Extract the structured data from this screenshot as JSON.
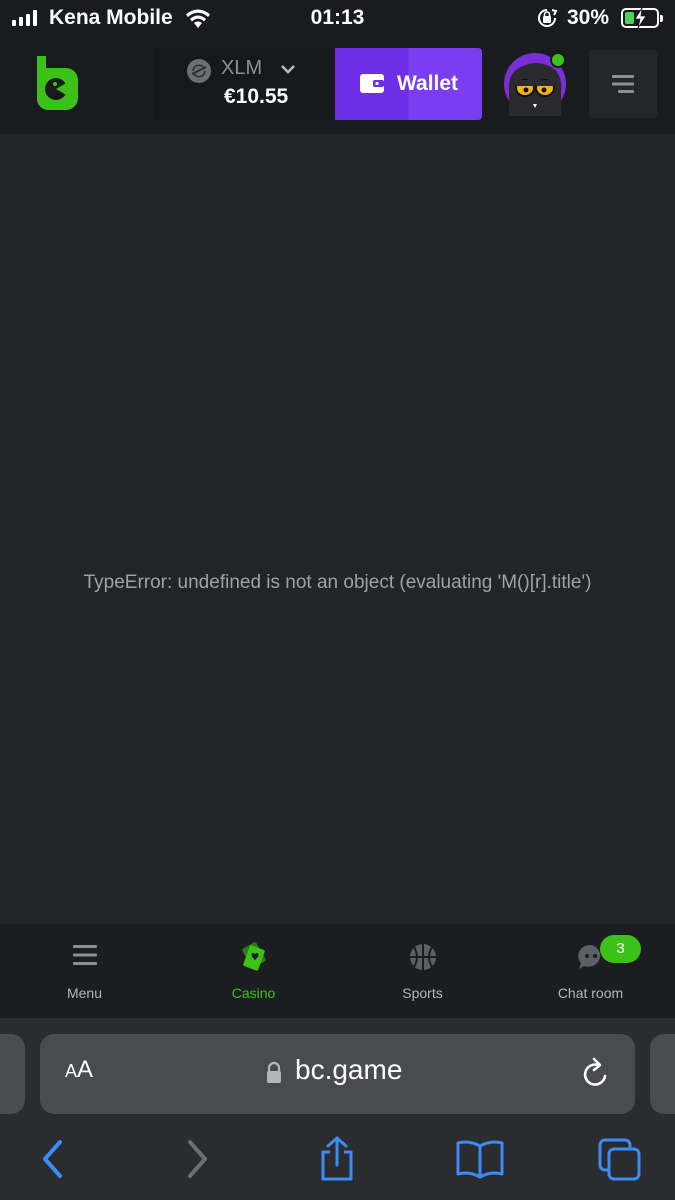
{
  "status_bar": {
    "carrier": "Kena Mobile",
    "time": "01:13",
    "battery_percent": "30%",
    "battery_level": 0.3,
    "icons": [
      "signal-icon",
      "wifi-icon",
      "orientation-lock-icon",
      "battery-charging-icon"
    ]
  },
  "header": {
    "logo": "bc-game-logo",
    "currency": {
      "name": "XLM",
      "amount": "€10.55",
      "icon": "stellar-icon"
    },
    "wallet_label": "Wallet",
    "wallet_icon": "wallet-icon",
    "avatar": "user-avatar",
    "online": true,
    "menu_icon": "menu-lines-icon"
  },
  "main": {
    "error_message": "TypeError: undefined is not an object (evaluating 'M()[r].title')"
  },
  "bottom_nav": {
    "items": [
      {
        "label": "Menu",
        "icon": "hamburger-icon",
        "active": false
      },
      {
        "label": "Casino",
        "icon": "casino-cards-icon",
        "active": true
      },
      {
        "label": "Sports",
        "icon": "basketball-icon",
        "active": false
      },
      {
        "label": "Chat room",
        "icon": "chat-bubble-icon",
        "active": false,
        "badge": "3"
      }
    ]
  },
  "browser": {
    "text_size_label_small": "A",
    "text_size_label_large": "A",
    "url": "bc.game",
    "toolbar_icons": [
      "back-icon",
      "forward-icon",
      "share-icon",
      "bookmarks-icon",
      "tabs-icon"
    ]
  },
  "colors": {
    "accent_green": "#3bc117",
    "wallet_purple": "#6e2ee8",
    "background": "#232427",
    "ios_blue": "#3b8cf5"
  }
}
